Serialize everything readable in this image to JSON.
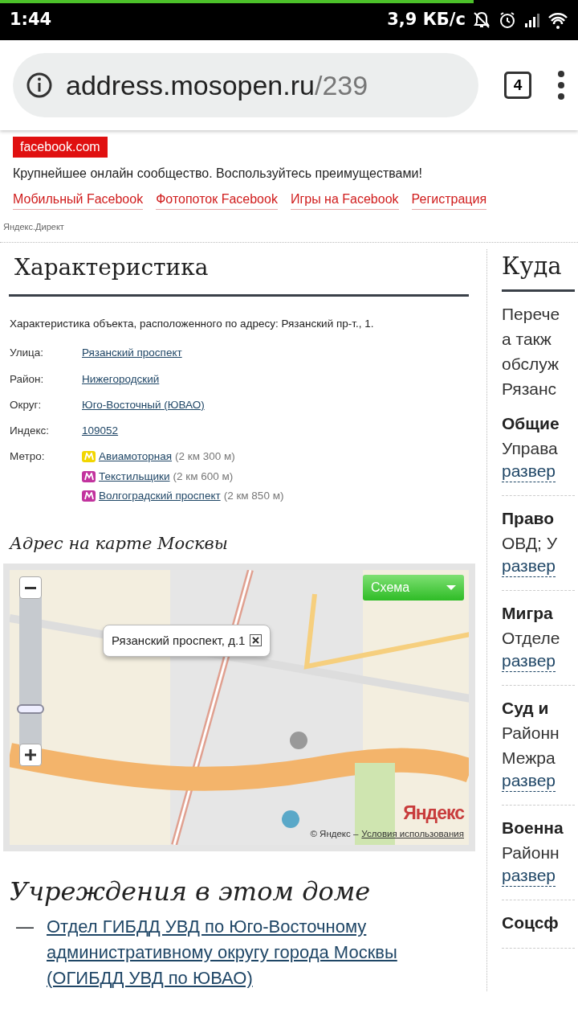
{
  "status_bar": {
    "time": "1:44",
    "speed": "3,9 КБ/с"
  },
  "browser": {
    "url_host": "address.mosopen.ru",
    "url_path": "/239",
    "tab_count": "4",
    "load_progress": {
      "level": 0.82
    }
  },
  "ad": {
    "badge": "facebook.com",
    "text": "Крупнейшее онлайн сообщество. Воспользуйтесь преимуществами!",
    "links": [
      "Мобильный Facebook",
      "Фотопоток Facebook",
      "Игры на Facebook",
      "Регистрация"
    ],
    "source": "Яндекс.Директ"
  },
  "characteristics": {
    "title": "Характеристика",
    "intro": "Характеристика объекта, расположенного по адресу: Рязанский пр-т., 1.",
    "fields": [
      {
        "label": "Улица:",
        "value": "Рязанский проспект"
      },
      {
        "label": "Район:",
        "value": "Нижегородский"
      },
      {
        "label": "Округ:",
        "value": "Юго-Восточный (ЮВАО)"
      },
      {
        "label": "Индекс:",
        "value": "109052"
      }
    ],
    "metro": {
      "label": "Метро:",
      "stations": [
        {
          "name": "Авиамоторная",
          "distance": "(2 км 300 м)",
          "color": "#f2d600"
        },
        {
          "name": "Текстильщики",
          "distance": "(2 км 600 м)",
          "color": "#c2339e"
        },
        {
          "name": "Волгоградский проспект",
          "distance": "(2 км 850 м)",
          "color": "#c2339e"
        }
      ]
    }
  },
  "map": {
    "title": "Адрес на карте Москвы",
    "layer_select": "Схема",
    "balloon": "Рязанский проспект, д.1",
    "zoom": {
      "level": 0.3
    },
    "logo": "Яндекс",
    "copyright": "© Яндекс –",
    "terms": "Условия использования"
  },
  "institutions": {
    "title": "Учреждения в этом доме",
    "items": [
      {
        "marker": "—",
        "link": "Отдел ГИБДД УВД по Юго-Восточному административному округу города Москвы (ОГИБДД УВД по ЮВАО)"
      }
    ]
  },
  "sidebar": {
    "title": "Куда",
    "intro": [
      "Перече",
      "а такж",
      "обслуж",
      "Рязанс"
    ],
    "sections": [
      {
        "title": "Общие",
        "lines": [
          "Управа"
        ],
        "toggle": "развер"
      },
      {
        "title": "Право",
        "lines": [
          "ОВД; У"
        ],
        "toggle": "развер"
      },
      {
        "title": "Мигра",
        "lines": [
          "Отделе"
        ],
        "toggle": "развер"
      },
      {
        "title": "Суд и",
        "lines": [
          "Районн",
          "Межра"
        ],
        "toggle": "развер"
      },
      {
        "title": "Военна",
        "lines": [
          "Районн"
        ],
        "toggle": "развер"
      },
      {
        "title": "Соцсф"
      }
    ]
  }
}
